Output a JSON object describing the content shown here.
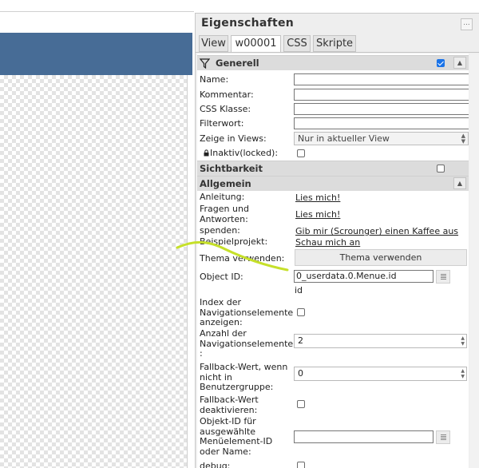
{
  "panel": {
    "title": "Eigenschaften",
    "menu_symbol": "..."
  },
  "tabs": [
    {
      "label": "View"
    },
    {
      "label": "w00001"
    },
    {
      "label": "CSS"
    },
    {
      "label": "Skripte"
    }
  ],
  "sections": {
    "generell": "Generell",
    "sichtbarkeit": "Sichtbarkeit",
    "allgemein": "Allgemein"
  },
  "generell": {
    "name_label": "Name:",
    "kommentar_label": "Kommentar:",
    "css_klasse_label": "CSS Klasse:",
    "filterwort_label": "Filterwort:",
    "zeige_label": "Zeige in Views:",
    "zeige_value": "Nur in aktueller View",
    "inaktiv_label": "Inaktiv(locked):"
  },
  "allgemein": {
    "anleitung_label": "Anleitung:",
    "anleitung_link": "Lies mich!",
    "fragen_label": "Fragen und Antworten:",
    "fragen_link": "Lies mich!",
    "spenden_label": "spenden:",
    "spenden_link": "Gib mir (Scrounger) einen Kaffee aus",
    "beispiel_label": "Beispielprojekt:",
    "beispiel_link": "Schau mich an",
    "thema_label": "Thema verwenden:",
    "thema_button": "Thema verwenden",
    "oid_label": "Object ID:",
    "oid_value": "0_userdata.0.Menue.id",
    "oid_sub": "id",
    "index_label": "Index der Navigationselemente anzeigen:",
    "anzahl_label": "Anzahl der Navigationselemente :",
    "anzahl_value": "2",
    "fallback_label": "Fallback-Wert, wenn nicht in Benutzergruppe:",
    "fallback_value": "0",
    "fallback_deakt_label": "Fallback-Wert deaktivieren:",
    "objekt_label": "Objekt-ID für ausgewählte Menüelement-ID oder Name:",
    "debug_label": "debug:"
  },
  "colors": {
    "header": "#476c96",
    "checkbox_accent": "#1a73e8",
    "annotation_stroke": "#c6e02a"
  }
}
